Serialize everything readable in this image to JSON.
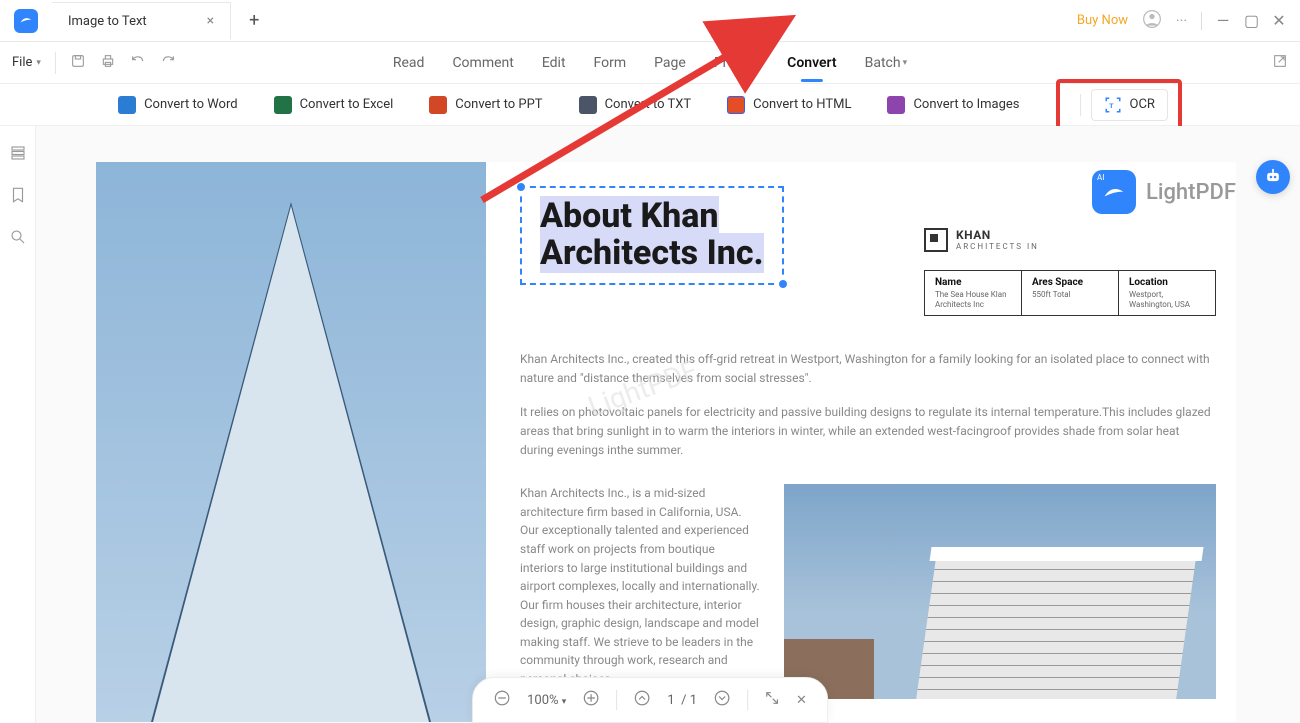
{
  "titlebar": {
    "tab_title": "Image to Text",
    "buy_now": "Buy Now"
  },
  "toolbar": {
    "file": "File",
    "tabs": [
      "Read",
      "Comment",
      "Edit",
      "Form",
      "Page",
      "Protect",
      "Convert",
      "Batch"
    ],
    "active_tab": "Convert"
  },
  "convertbar": {
    "word": "Convert to Word",
    "excel": "Convert to Excel",
    "ppt": "Convert to PPT",
    "txt": "Convert to TXT",
    "html": "Convert to HTML",
    "images": "Convert to Images",
    "ocr": "OCR"
  },
  "document": {
    "heading_line1": "About Khan",
    "heading_line2": "Architects Inc.",
    "brand_name": "KHAN",
    "brand_sub": "ARCHITECTS IN",
    "lightpdf": "LightPDF",
    "table": {
      "name_lbl": "Name",
      "name_val": "The Sea House Klan Architects Inc",
      "area_lbl": "Ares Space",
      "area_val": "550ft Total",
      "loc_lbl": "Location",
      "loc_val": "Westport, Washington, USA"
    },
    "p1": "Khan Architects Inc., created this off-grid retreat in Westport, Washington for a family looking for an isolated place to connect with nature and \"distance themselves from social stresses\".",
    "p2": "It relies on photovoltaic panels for electricity and passive building designs to regulate its internal temperature.This includes glazed areas that bring sunlight in to warm the interiors in winter, while an extended west-facingroof provides shade from solar heat during evenings inthe summer.",
    "p3": "Khan Architects Inc., is a mid-sized architecture firm based in California, USA. Our exceptionally talented and experienced staff work on projects from boutique interiors to large institutional buildings and airport complexes, locally and internationally. Our firm houses their architecture, interior design, graphic design, landscape and model making staff. We strieve to be leaders in the community through work, research and personal choices.",
    "watermark": "LightPDF"
  },
  "statusbar": {
    "zoom": "100%",
    "page_current": "1",
    "page_sep": "/",
    "page_total": "1"
  }
}
